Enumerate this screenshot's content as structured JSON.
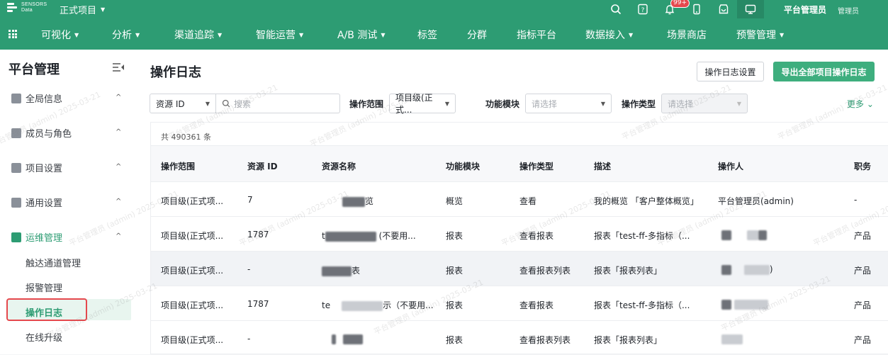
{
  "topbar": {
    "logo_line1": "SENSORS",
    "logo_line2": "Data",
    "project": "正式项目",
    "badge": "99+",
    "user": "平台管理员",
    "role": "管理员"
  },
  "nav": {
    "items": [
      {
        "label": "可视化",
        "caret": true
      },
      {
        "label": "分析",
        "caret": true
      },
      {
        "label": "渠道追踪",
        "caret": true
      },
      {
        "label": "智能运营",
        "caret": true
      },
      {
        "label": "A/B 测试",
        "caret": true
      },
      {
        "label": "标签",
        "caret": false
      },
      {
        "label": "分群",
        "caret": false
      },
      {
        "label": "指标平台",
        "caret": false
      },
      {
        "label": "数据接入",
        "caret": true
      },
      {
        "label": "场景商店",
        "caret": false
      },
      {
        "label": "预警管理",
        "caret": true
      }
    ]
  },
  "sidebar": {
    "title": "平台管理",
    "groups": [
      {
        "label": "全局信息"
      },
      {
        "label": "成员与角色"
      },
      {
        "label": "项目设置"
      },
      {
        "label": "通用设置"
      },
      {
        "label": "运维管理"
      }
    ],
    "items": [
      {
        "label": "触达通道管理"
      },
      {
        "label": "报警管理"
      },
      {
        "label": "操作日志"
      },
      {
        "label": "在线升级"
      }
    ]
  },
  "main": {
    "title": "操作日志",
    "settings_button": "操作日志设置",
    "export_button": "导出全部项目操作日志"
  },
  "filters": {
    "resource_type": "资源 ID",
    "search_placeholder": "搜索",
    "scope_label": "操作范围",
    "scope_value": "项目级(正式...",
    "module_label": "功能模块",
    "module_placeholder": "请选择",
    "optype_label": "操作类型",
    "optype_placeholder": "请选择",
    "more": "更多"
  },
  "table": {
    "total": "共 490361 条",
    "headers": [
      "操作范围",
      "资源 ID",
      "资源名称",
      "功能模块",
      "操作类型",
      "描述",
      "操作人",
      "职务"
    ],
    "rows": [
      {
        "scope": "项目级(正式项...",
        "rid": "7",
        "name_tail": "览",
        "module": "概览",
        "type": "查看",
        "desc": "我的概览 「客户整体概览」",
        "user": "平台管理员(admin)",
        "job": "-"
      },
      {
        "scope": "项目级(正式项...",
        "rid": "1787",
        "name_head": "t",
        "name_tail": "(不要用...",
        "module": "报表",
        "type": "查看报表",
        "desc": "报表「test-ff-多指标（...",
        "user": "",
        "job": "产品"
      },
      {
        "scope": "项目级(正式项...",
        "rid": "-",
        "name_tail": "表",
        "module": "报表",
        "type": "查看报表列表",
        "desc": "报表「报表列表」",
        "user": ")",
        "job": "产品"
      },
      {
        "scope": "项目级(正式项...",
        "rid": "1787",
        "name_head": "te",
        "name_tail": "示（不要用...",
        "module": "报表",
        "type": "查看报表",
        "desc": "报表「test-ff-多指标（...",
        "user": "",
        "job": "产品"
      },
      {
        "scope": "项目级(正式项...",
        "rid": "-",
        "name_tail": "",
        "module": "报表",
        "type": "查看报表列表",
        "desc": "报表「报表列表」",
        "user": "",
        "job": "产品"
      }
    ]
  },
  "watermark": "平台管理员 (admin) 2025-03-21",
  "colors": {
    "brand": "#2d9c73",
    "export": "#3eae7e",
    "highlight": "#e5484d"
  }
}
